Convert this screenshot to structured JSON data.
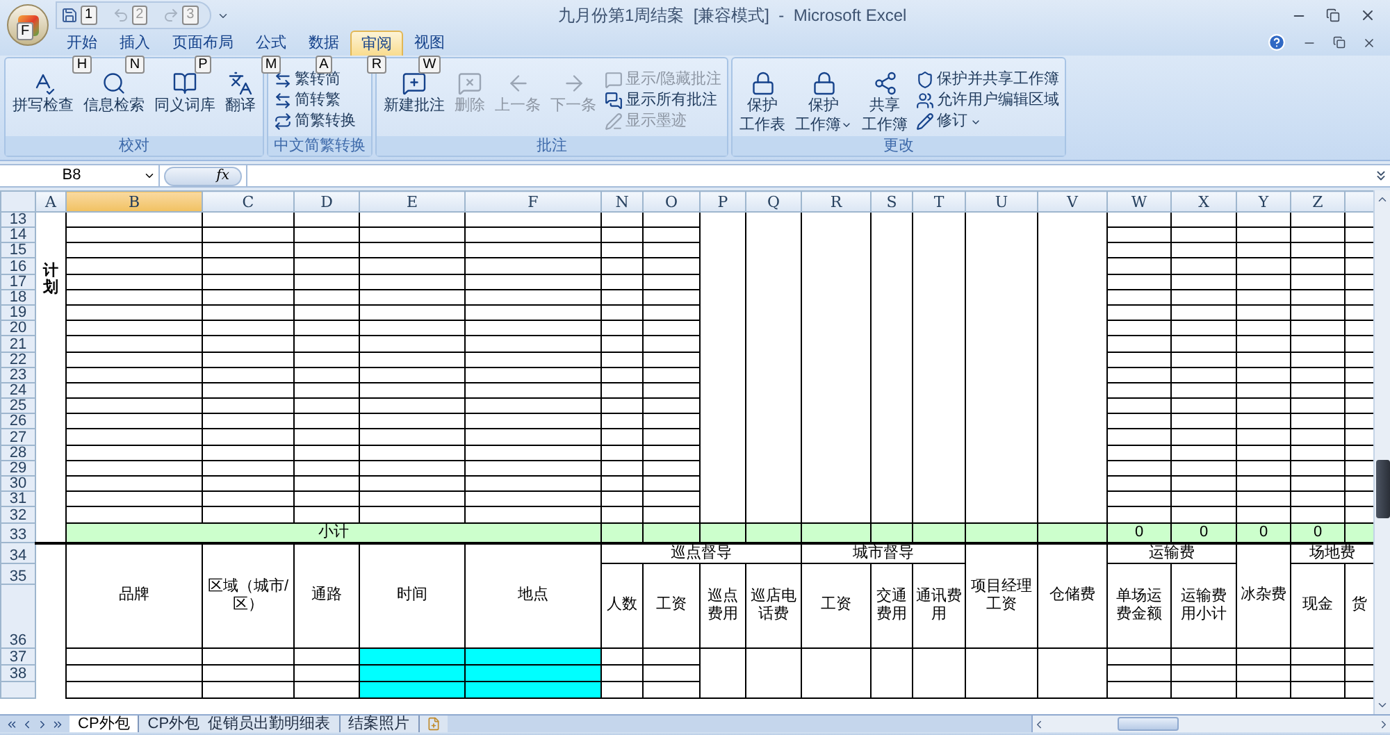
{
  "window": {
    "title": "九月份第1周结案  [兼容模式]  -  Microsoft Excel"
  },
  "office_button": {
    "keytip": "F"
  },
  "quick_access": [
    {
      "keytip": "1",
      "disabled": false
    },
    {
      "keytip": "2",
      "disabled": true
    },
    {
      "keytip": "3",
      "disabled": true
    }
  ],
  "tabs": [
    {
      "label": "开始",
      "keytip": "H",
      "selected": false
    },
    {
      "label": "插入",
      "keytip": "N",
      "selected": false
    },
    {
      "label": "页面布局",
      "keytip": "P",
      "selected": false
    },
    {
      "label": "公式",
      "keytip": "M",
      "selected": false
    },
    {
      "label": "数据",
      "keytip": "A",
      "selected": false
    },
    {
      "label": "审阅",
      "keytip": "R",
      "selected": true
    },
    {
      "label": "视图",
      "keytip": "W",
      "selected": false
    }
  ],
  "ribbon_groups": [
    {
      "label": "校对",
      "items": [
        {
          "kind": "large",
          "lines": [
            "拼写检查"
          ],
          "disabled": false,
          "dropdown": false
        },
        {
          "kind": "large",
          "lines": [
            "信息检索"
          ],
          "disabled": false,
          "dropdown": false
        },
        {
          "kind": "large",
          "lines": [
            "同义词库"
          ],
          "disabled": false,
          "dropdown": false
        },
        {
          "kind": "large",
          "lines": [
            "翻译"
          ],
          "disabled": false,
          "dropdown": false
        }
      ]
    },
    {
      "label": "中文简繁转换",
      "items": [
        {
          "kind": "small",
          "lines": [
            "繁转简"
          ],
          "disabled": false,
          "dropdown": false
        },
        {
          "kind": "small",
          "lines": [
            "简转繁"
          ],
          "disabled": false,
          "dropdown": false
        },
        {
          "kind": "small",
          "lines": [
            "简繁转换"
          ],
          "disabled": false,
          "dropdown": false
        }
      ]
    },
    {
      "label": "批注",
      "items": [
        {
          "kind": "large",
          "lines": [
            "新建批注"
          ],
          "disabled": false,
          "dropdown": false
        },
        {
          "kind": "large",
          "lines": [
            "删除"
          ],
          "disabled": true,
          "dropdown": false
        },
        {
          "kind": "large",
          "lines": [
            "上一条"
          ],
          "disabled": true,
          "dropdown": false
        },
        {
          "kind": "large",
          "lines": [
            "下一条"
          ],
          "disabled": true,
          "dropdown": false
        },
        {
          "kind": "small",
          "lines": [
            "显示/隐藏批注"
          ],
          "disabled": true,
          "dropdown": false
        },
        {
          "kind": "small",
          "lines": [
            "显示所有批注"
          ],
          "disabled": false,
          "dropdown": false
        },
        {
          "kind": "small",
          "lines": [
            "显示墨迹"
          ],
          "disabled": true,
          "dropdown": false
        }
      ]
    },
    {
      "label": "更改",
      "items": [
        {
          "kind": "large",
          "lines": [
            "保护",
            "工作表"
          ],
          "disabled": false,
          "dropdown": false
        },
        {
          "kind": "large",
          "lines": [
            "保护",
            "工作簿"
          ],
          "disabled": false,
          "dropdown": true
        },
        {
          "kind": "large",
          "lines": [
            "共享",
            "工作簿"
          ],
          "disabled": false,
          "dropdown": false
        },
        {
          "kind": "small",
          "lines": [
            "保护并共享工作簿"
          ],
          "disabled": false,
          "dropdown": false
        },
        {
          "kind": "small",
          "lines": [
            "允许用户编辑区域"
          ],
          "disabled": false,
          "dropdown": false
        },
        {
          "kind": "small",
          "lines": [
            "修订"
          ],
          "disabled": false,
          "dropdown": true
        }
      ]
    }
  ],
  "formula_bar": {
    "name_box": "B8",
    "function_label": "fx"
  },
  "columns": [
    {
      "label": "A",
      "selected": false
    },
    {
      "label": "B",
      "selected": true
    },
    {
      "label": "C",
      "selected": false
    },
    {
      "label": "D",
      "selected": false
    },
    {
      "label": "E",
      "selected": false
    },
    {
      "label": "F",
      "selected": false
    },
    {
      "label": "N",
      "selected": false
    },
    {
      "label": "O",
      "selected": false
    },
    {
      "label": "P",
      "selected": false
    },
    {
      "label": "Q",
      "selected": false
    },
    {
      "label": "R",
      "selected": false
    },
    {
      "label": "S",
      "selected": false
    },
    {
      "label": "T",
      "selected": false
    },
    {
      "label": "U",
      "selected": false
    },
    {
      "label": "V",
      "selected": false
    },
    {
      "label": "W",
      "selected": false
    },
    {
      "label": "X",
      "selected": false
    },
    {
      "label": "Y",
      "selected": false
    },
    {
      "label": "Z",
      "selected": false
    }
  ],
  "row_numbers": [
    "13",
    "14",
    "15",
    "16",
    "17",
    "18",
    "19",
    "20",
    "21",
    "22",
    "23",
    "24",
    "25",
    "26",
    "27",
    "28",
    "29",
    "30",
    "31",
    "32",
    "33",
    "34",
    "35",
    "36",
    "37",
    "38"
  ],
  "plan_label": "计划",
  "subtotal": {
    "label": "小计",
    "values": [
      "0",
      "0",
      "0",
      "0"
    ]
  },
  "header_left": [
    "品牌",
    "区域（城市/区）",
    "通路",
    "时间",
    "地点"
  ],
  "header_groups": [
    {
      "kind": "group",
      "label": "巡点督导",
      "columns": [
        "人数",
        "工资",
        "巡点费用",
        "巡店电话费"
      ]
    },
    {
      "kind": "group",
      "label": "城市督导",
      "columns": [
        "工资",
        "交通费用",
        "通讯费用"
      ]
    },
    {
      "kind": "single",
      "label": "项目经理工资"
    },
    {
      "kind": "single",
      "label": "仓储费"
    },
    {
      "kind": "group",
      "label": "运输费",
      "columns": [
        "单场运费金额",
        "运输费用小计"
      ]
    },
    {
      "kind": "single",
      "label": "冰杂费"
    },
    {
      "kind": "group",
      "label": "场地费",
      "columns": [
        "现金",
        "货"
      ]
    }
  ],
  "sheet_tabs": [
    {
      "label": "CP外包",
      "selected": true
    },
    {
      "label": "CP外包  促销员出勤明细表",
      "selected": false
    },
    {
      "label": "结案照片",
      "selected": false
    }
  ]
}
